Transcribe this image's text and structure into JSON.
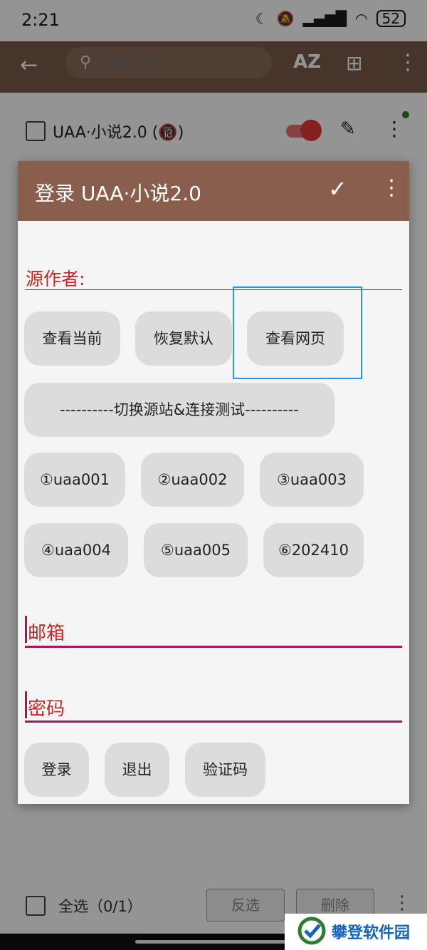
{
  "status_bar": {
    "time": "2:21",
    "battery": "52",
    "icons": [
      "moon-icon",
      "mute-icon",
      "signal-icon",
      "wifi-icon",
      "battery-icon"
    ]
  },
  "app_bar": {
    "search_placeholder": "搜索书源",
    "az_label": "AZ",
    "colors": {
      "background": "#7b5b4a"
    }
  },
  "list": {
    "items": [
      {
        "name": "UAA·小说2.0 (🔞)",
        "enabled": true
      }
    ]
  },
  "dialog": {
    "title": "登录 UAA·小说2.0",
    "author_label": "源作者:",
    "buttons_row1": [
      "查看当前",
      "恢复默认",
      "查看网页"
    ],
    "switch_label": "----------切换源站&连接测试----------",
    "site_row1": [
      "①uaa001",
      "②uaa002",
      "③uaa003"
    ],
    "site_row2": [
      "④uaa004",
      "⑤uaa005",
      "⑥202410"
    ],
    "email_label": "邮箱",
    "password_label": "密码",
    "action_buttons": [
      "登录",
      "退出",
      "验证码"
    ],
    "colors": {
      "toolbar": "#8a5e4c",
      "label": "#c62828",
      "underline": "#ad1457",
      "highlight": "#2196f3"
    }
  },
  "bottom_bar": {
    "select_all": "全选（0/1）",
    "invert": "反选",
    "delete": "删除"
  },
  "watermark": {
    "text": "攀登软件园"
  }
}
